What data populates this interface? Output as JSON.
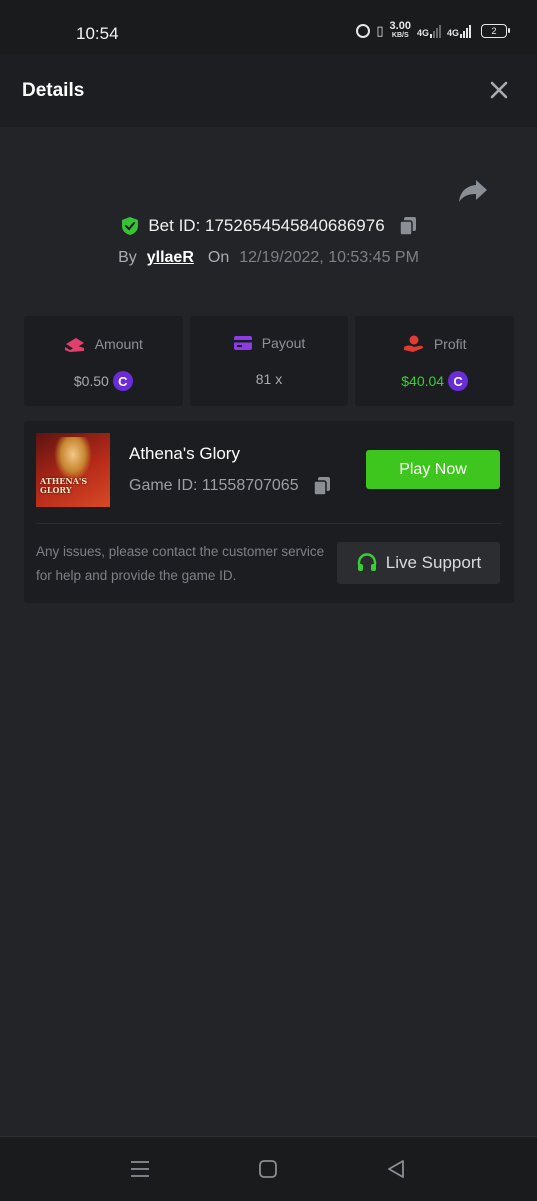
{
  "status_bar": {
    "time": "10:54",
    "speed_value": "3.00",
    "speed_unit": "KB/S",
    "network_1": "4G",
    "network_2": "4G",
    "battery": "2"
  },
  "header": {
    "title": "Details",
    "close_icon": "close-icon"
  },
  "bet": {
    "id_label": "Bet ID: 1752654545840686976",
    "by_label": "By",
    "user": "yllaeR",
    "on_label": "On",
    "datetime": "12/19/2022, 10:53:45 PM"
  },
  "stats": [
    {
      "label": "Amount",
      "value": "$0.50",
      "icon": "money-icon",
      "has_coin": true
    },
    {
      "label": "Payout",
      "value": "81 x",
      "icon": "card-icon",
      "has_coin": false
    },
    {
      "label": "Profit",
      "value": "$40.04",
      "icon": "hand-coin-icon",
      "has_coin": true
    }
  ],
  "coin_symbol": "C",
  "game": {
    "name": "Athena's Glory",
    "id_label": "Game ID: 11558707065",
    "thumb_text_1": "ATHENA'S",
    "thumb_text_2": "GLORY",
    "play_label": "Play Now",
    "issues_text": "Any issues, please contact the customer service for help and provide the game ID.",
    "support_label": "Live Support"
  },
  "colors": {
    "background": "#232427",
    "accent_green": "#3fc61e",
    "profit_green": "#3ccd36",
    "coin_purple": "#6a2bd8"
  }
}
